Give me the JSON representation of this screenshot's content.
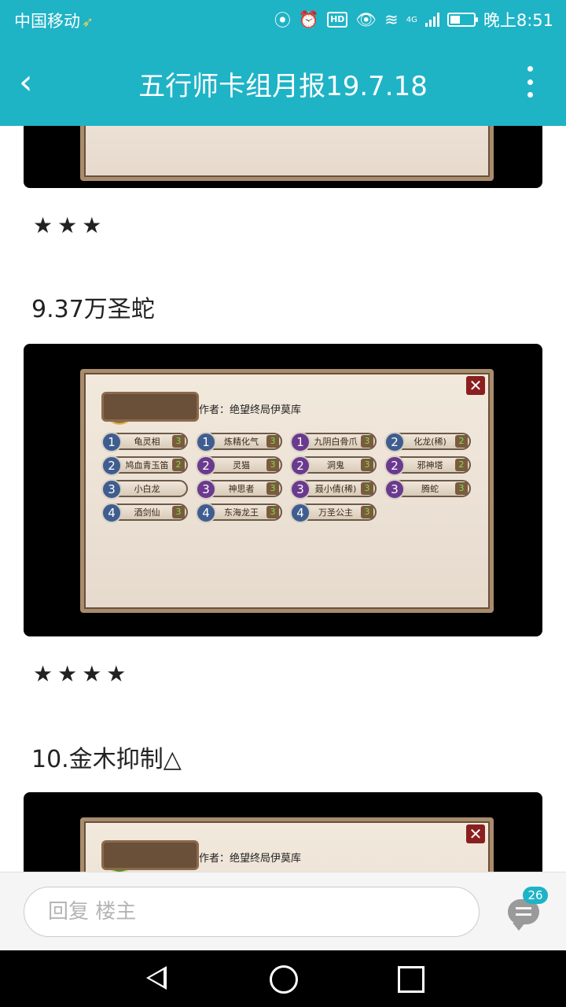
{
  "status_bar": {
    "carrier": "中国移动",
    "network": "4G",
    "hd_label": "HD",
    "time": "晚上8:51",
    "battery_level": 0.45
  },
  "title_bar": {
    "back_icon": "chevron-left-icon",
    "title": "五行师卡组月报19.7.18",
    "more_icon": "more-vertical-icon"
  },
  "post": {
    "stars_1": "★★★",
    "heading_2": "9.37万圣蛇",
    "deck_2": {
      "author_label": "作者：绝望终局伊莫库",
      "cards": [
        {
          "cost": "1",
          "name": "龟灵相",
          "count": "3",
          "color": "blue"
        },
        {
          "cost": "1",
          "name": "炼精化气",
          "count": "3",
          "color": "blue"
        },
        {
          "cost": "1",
          "name": "九阴白骨爪",
          "count": "3",
          "color": "purple"
        },
        {
          "cost": "2",
          "name": "化龙(稀)",
          "count": "2",
          "color": "blue"
        },
        {
          "cost": "2",
          "name": "鸠血青玉笛",
          "count": "2",
          "color": "blue"
        },
        {
          "cost": "2",
          "name": "灵猫",
          "count": "3",
          "color": "purple"
        },
        {
          "cost": "2",
          "name": "洞鬼",
          "count": "3",
          "color": "purple"
        },
        {
          "cost": "2",
          "name": "邪神塔",
          "count": "2",
          "color": "purple"
        },
        {
          "cost": "3",
          "name": "小白龙",
          "count": "",
          "color": "blue"
        },
        {
          "cost": "3",
          "name": "神思者",
          "count": "3",
          "color": "purple"
        },
        {
          "cost": "3",
          "name": "聂小倩(稀)",
          "count": "3",
          "color": "purple"
        },
        {
          "cost": "3",
          "name": "腾蛇",
          "count": "3",
          "color": "purple"
        },
        {
          "cost": "4",
          "name": "酒剑仙",
          "count": "3",
          "color": "blue"
        },
        {
          "cost": "4",
          "name": "东海龙王",
          "count": "3",
          "color": "blue"
        },
        {
          "cost": "4",
          "name": "万圣公主",
          "count": "3",
          "color": "blue"
        }
      ]
    },
    "stars_2": "★★★★",
    "heading_3": "10.金木抑制△",
    "deck_3": {
      "author_label": "作者：绝望终局伊莫库"
    }
  },
  "reply_bar": {
    "placeholder": "回复  楼主",
    "comment_count": "26",
    "comment_icon": "comment-icon"
  },
  "nav_bar": {
    "back": "nav-back-icon",
    "home": "nav-home-icon",
    "recent": "nav-recent-icon"
  }
}
